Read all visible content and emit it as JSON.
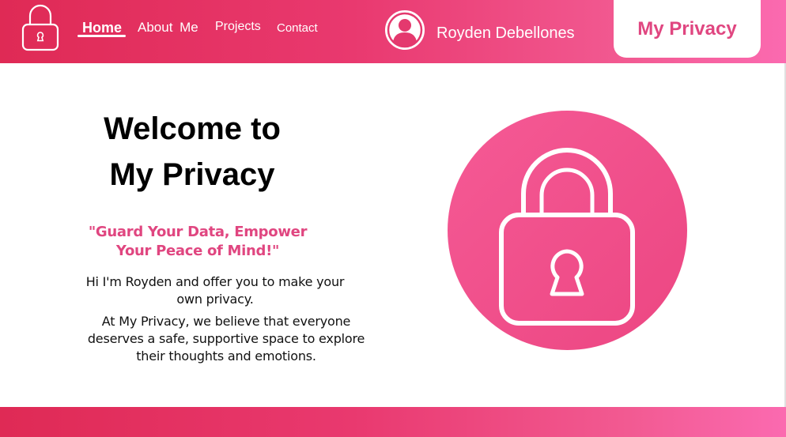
{
  "nav": {
    "home": "Home",
    "about": "About Me",
    "projects": "Projects",
    "contact": "Contact"
  },
  "user": {
    "name": "Royden Debellones"
  },
  "brand_button": "My Privacy",
  "hero": {
    "title_line1": "Welcome to",
    "title_line2": "My Privacy",
    "tagline": "\"Guard Your Data, Empower Your Peace of Mind!\"",
    "intro": "Hi I'm Royden and offer you to make your own privacy.",
    "about": "At My Privacy, we believe that everyone deserves a safe, supportive space to explore their thoughts and emotions."
  },
  "icons": {
    "logo": "lock-icon",
    "avatar": "user-avatar-icon",
    "hero": "lock-icon"
  },
  "colors": {
    "accent": "#e04680",
    "gradient_start": "#df2a55",
    "gradient_end": "#fb6ab0",
    "lock_circle": "#f2508c"
  }
}
